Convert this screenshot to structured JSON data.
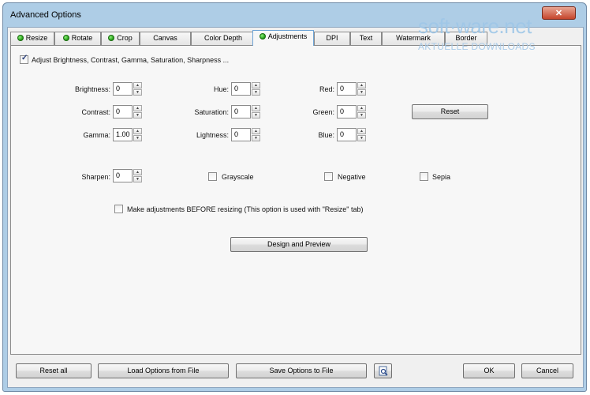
{
  "window": {
    "title": "Advanced Options",
    "close_glyph": "✕"
  },
  "tabs": [
    {
      "label": "Resize",
      "indicator": true
    },
    {
      "label": "Rotate",
      "indicator": true
    },
    {
      "label": "Crop",
      "indicator": true
    },
    {
      "label": "Canvas",
      "indicator": false
    },
    {
      "label": "Color Depth",
      "indicator": false
    },
    {
      "label": "Adjustments",
      "indicator": true,
      "active": true
    },
    {
      "label": "DPI",
      "indicator": false
    },
    {
      "label": "Text",
      "indicator": false
    },
    {
      "label": "Watermark",
      "indicator": false
    },
    {
      "label": "Border",
      "indicator": false
    }
  ],
  "adjust": {
    "enable_label": "Adjust Brightness, Contrast, Gamma, Saturation, Sharpness ...",
    "brightness": {
      "label": "Brightness:",
      "value": "0"
    },
    "contrast": {
      "label": "Contrast:",
      "value": "0"
    },
    "gamma": {
      "label": "Gamma:",
      "value": "1.00"
    },
    "hue": {
      "label": "Hue:",
      "value": "0"
    },
    "saturation": {
      "label": "Saturation:",
      "value": "0"
    },
    "lightness": {
      "label": "Lightness:",
      "value": "0"
    },
    "red": {
      "label": "Red:",
      "value": "0"
    },
    "green": {
      "label": "Green:",
      "value": "0"
    },
    "blue": {
      "label": "Blue:",
      "value": "0"
    },
    "sharpen": {
      "label": "Sharpen:",
      "value": "0"
    },
    "grayscale_label": "Grayscale",
    "negative_label": "Negative",
    "sepia_label": "Sepia",
    "reset_label": "Reset",
    "before_resize_label": "Make adjustments BEFORE resizing (This option is used with \"Resize\" tab)",
    "design_preview_label": "Design and Preview"
  },
  "footer": {
    "reset_all": "Reset all",
    "load": "Load Options from File",
    "save": "Save Options to File",
    "ok": "OK",
    "cancel": "Cancel"
  },
  "watermark": {
    "brand": "soft·ware.net",
    "tagline": "AKTUELLE DOWNLOADS"
  },
  "colors": {
    "frame": "#aecde6",
    "indicator": "#1f9a12",
    "close": "#c5452c"
  }
}
